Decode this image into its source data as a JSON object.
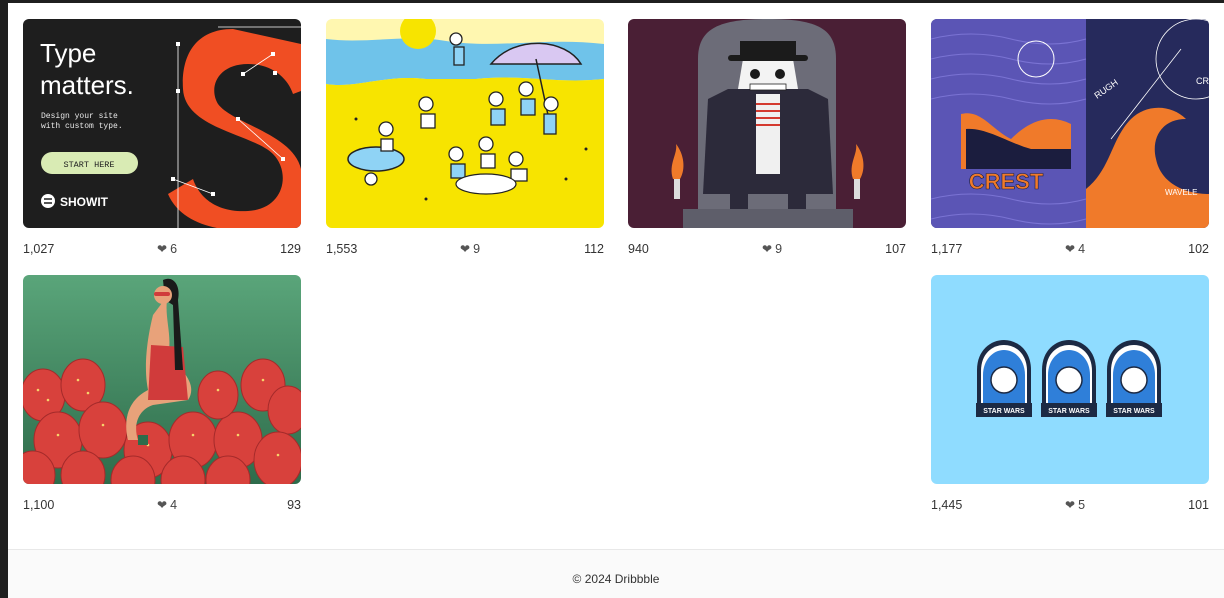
{
  "shots": [
    {
      "name": "showit-type-ad",
      "views": "1,027",
      "likes": "6",
      "comments": "129",
      "heading_line1": "Type",
      "heading_line2": "matters.",
      "sub_line1": "Design your site",
      "sub_line2": "with custom type.",
      "cta": "START HERE",
      "brand": "SHOWIT",
      "big_letter": "S"
    },
    {
      "name": "beach-illustration",
      "views": "1,553",
      "likes": "9",
      "comments": "112"
    },
    {
      "name": "skeleton-illustration",
      "views": "940",
      "likes": "9",
      "comments": "107"
    },
    {
      "name": "crest-poster",
      "views": "1,177",
      "likes": "4",
      "comments": "102",
      "title": "CREST",
      "label": "WAVELE",
      "side": "RUGH",
      "corner": "CR"
    },
    {
      "name": "strawberry-woman",
      "views": "1,100",
      "likes": "4",
      "comments": "93"
    },
    {
      "name": "star-wars-badges",
      "views": "1,445",
      "likes": "5",
      "comments": "101",
      "badge_text": "STAR WARS"
    }
  ],
  "footer": {
    "copyright": "© 2024 Dribbble"
  },
  "colors": {
    "bg": "#1f1f1f",
    "page": "#ffffff",
    "accent_orange": "#f04e23",
    "sky": "#8fdcff"
  }
}
